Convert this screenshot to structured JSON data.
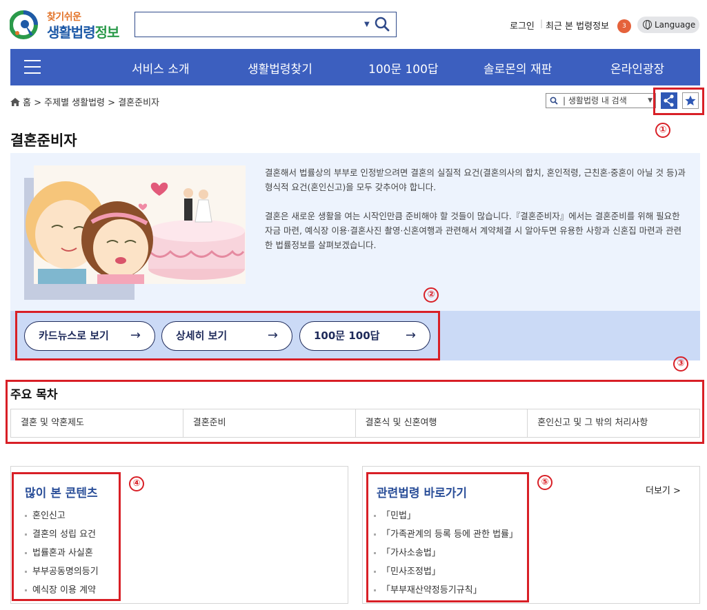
{
  "header": {
    "logo_small": "찾기쉬운",
    "logo_big_main": "생활법령",
    "logo_big_tail": "정보",
    "search_placeholder": "",
    "login": "로그인",
    "separator": "|",
    "recent": "최근 본 법령정보",
    "recent_count": "3",
    "language": "Language"
  },
  "nav": {
    "items": [
      "서비스 소개",
      "생활법령찾기",
      "100문 100답",
      "솔로몬의 재판",
      "온라인광장"
    ]
  },
  "breadcrumb": [
    "홈",
    "주제별 생활법령",
    "결혼준비자"
  ],
  "breadcrumb_sep": ">",
  "inner_search_label": "| 생활법령 내 검색",
  "page_title": "결혼준비자",
  "intro": {
    "p1": "결혼해서 법률상의 부부로 인정받으려면 결혼의 실질적 요건(결혼의사의 합치, 혼인적령, 근친혼·중혼이 아닐 것 등)과 형식적 요건(혼인신고)을 모두 갖추어야 합니다.",
    "p2": "결혼은 새로운 생활을 여는 시작인만큼 준비해야 할 것들이 많습니다.『결혼준비자』에서는 결혼준비를 위해 필요한 자금 마련, 예식장 이용·결혼사진 촬영·신혼여행과 관련해서 계약체결 시 알아두면 유용한 사항과 신혼집 마련과 관련한 법률정보를 살펴보겠습니다."
  },
  "cta": [
    "카드뉴스로 보기",
    "상세히 보기",
    "100문 100답"
  ],
  "toc": {
    "title": "주요 목차",
    "items": [
      "결혼 및 약혼제도",
      "결혼준비",
      "결혼식 및 신혼여행",
      "혼인신고 및 그 밖의 처리사항"
    ]
  },
  "popular": {
    "title": "많이 본 콘텐츠",
    "items": [
      "혼인신고",
      "결혼의 성립 요건",
      "법률혼과 사실혼",
      "부부공동명의등기",
      "예식장 이용 계약"
    ]
  },
  "related": {
    "title": "관련법령 바로가기",
    "more": "더보기 >",
    "items": [
      "「민법」",
      "「가족관계의 등록 등에 관한 법률」",
      "「가사소송법」",
      "「민사조정법」",
      "「부부재산약정등기규칙」"
    ]
  },
  "annotations": [
    "①",
    "②",
    "③",
    "④",
    "⑤"
  ],
  "colors": {
    "nav_bg": "#3c5fbf",
    "intro_bg": "#edf3fd",
    "cta_bar_bg": "#cbdaf6",
    "annotation_red": "#d81f26",
    "card_title": "#2b4f99",
    "badge": "#e5623b"
  },
  "icons": {
    "search": "search-icon",
    "home": "home-icon",
    "share": "share-icon",
    "star": "star-icon",
    "globe": "globe-icon",
    "menu": "hamburger-menu-icon",
    "arrow": "arrow-right-icon"
  }
}
